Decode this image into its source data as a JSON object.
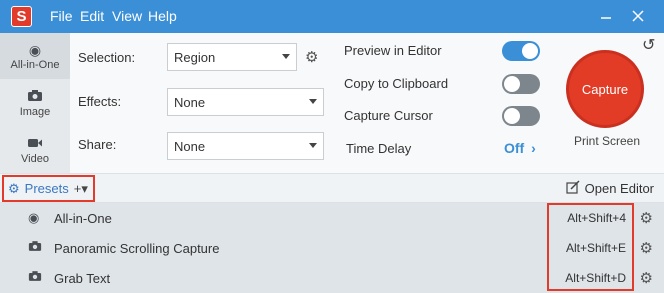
{
  "menu": {
    "file": "File",
    "edit": "Edit",
    "view": "View",
    "help": "Help"
  },
  "icons": {
    "app_logo": "snagit-logo",
    "close": "close-icon",
    "minimize": "minimize-icon"
  },
  "modes": [
    {
      "label": "All-in-One",
      "icon": "radio-target-icon"
    },
    {
      "label": "Image",
      "icon": "camera-icon"
    },
    {
      "label": "Video",
      "icon": "video-camera-icon"
    }
  ],
  "settings": {
    "selection_label": "Selection:",
    "selection_value": "Region",
    "effects_label": "Effects:",
    "effects_value": "None",
    "share_label": "Share:",
    "share_value": "None"
  },
  "options": {
    "preview_label": "Preview in Editor",
    "preview_on": true,
    "clipboard_label": "Copy to Clipboard",
    "clipboard_on": false,
    "cursor_label": "Capture Cursor",
    "cursor_on": false,
    "delay_label": "Time Delay",
    "delay_value": "Off"
  },
  "capture": {
    "button_label": "Capture",
    "hotkey_label": "Print Screen",
    "accent": "#e23b26"
  },
  "presets_bar": {
    "presets_label": "Presets",
    "open_editor_label": "Open Editor"
  },
  "presets": [
    {
      "name": "All-in-One",
      "hotkey": "Alt+Shift+4",
      "icon": "radio-target-icon"
    },
    {
      "name": "Panoramic Scrolling Capture",
      "hotkey": "Alt+Shift+E",
      "icon": "camera-icon"
    },
    {
      "name": "Grab Text",
      "hotkey": "Alt+Shift+D",
      "icon": "camera-icon"
    }
  ],
  "colors": {
    "titlebar": "#3a8fd6",
    "highlight": "#e23b2b"
  }
}
